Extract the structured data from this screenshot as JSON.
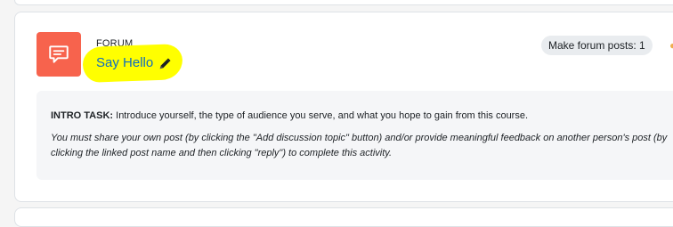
{
  "activity": {
    "type_label": "FORUM",
    "title": "Say Hello",
    "completion_badge": "Make forum posts: 1",
    "icon": "forum-chat-icon",
    "icon_color": "#f7634d",
    "highlight_color": "#ffff00",
    "link_color": "#0f6cbf"
  },
  "description": {
    "intro_label": "INTRO TASK:",
    "intro_text": " Introduce yourself, the type of audience you serve, and what you hope to gain from this course.",
    "instructions": "You must share your own post (by clicking the \"Add discussion topic\" button) and/or provide meaningful feedback on another person's post (by clicking the linked post name and then clicking \"reply\") to complete this activity."
  }
}
